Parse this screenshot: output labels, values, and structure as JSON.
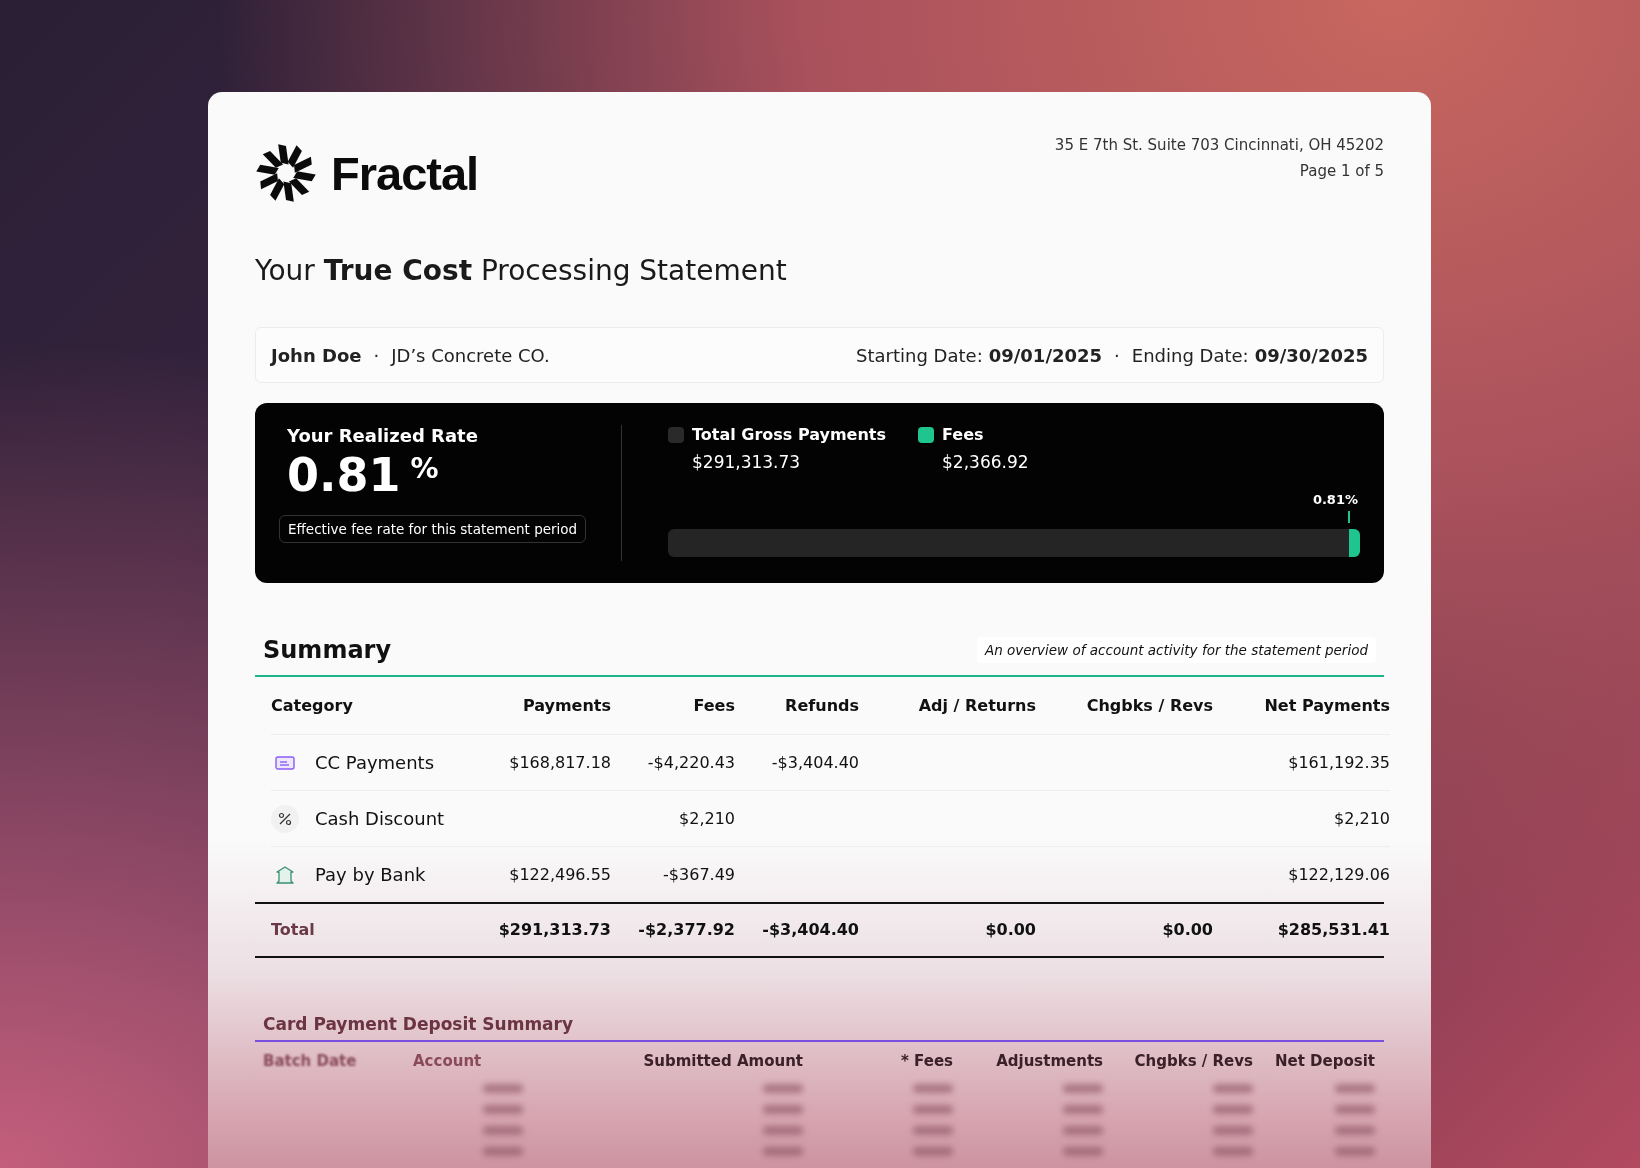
{
  "brand": {
    "name": "Fractal"
  },
  "address": "35 E 7th St. Suite 703 Cincinnati, OH 45202",
  "page": "Page 1 of 5",
  "title": "Your **True Cost** Processing Statement",
  "info": {
    "name": "John Doe",
    "separator": "·",
    "company": "JD’s Concrete CO.",
    "start_label": "Starting Date:",
    "start": "09/01/2025",
    "separator2": "·",
    "end_label": "Ending Date:",
    "end": "09/30/2025"
  },
  "rate": {
    "label": "Your Realized Rate",
    "value": "0.81",
    "unit": "%",
    "caption": "Effective fee rate for this statement period"
  },
  "legend": [
    {
      "label": "Total Gross Payments",
      "amount": "$291,313.73",
      "color": "#2a2a2a"
    },
    {
      "label": "Fees",
      "amount": "$2,366.92",
      "color": "#1fc58e"
    }
  ],
  "meter": {
    "level": 0.0081,
    "reading": "0.81%"
  },
  "summary": {
    "title": "Summary",
    "note": "An overview of account activity for the statement period",
    "columns": [
      "Category",
      "Payments",
      "Fees",
      "Refunds",
      "Adj / Returns",
      "Chgbks / Revs",
      "Net Payments"
    ],
    "rows": [
      {
        "kind": "card",
        "cells": [
          "CC Payments",
          "$168,817.18",
          "-$4,220.43",
          "-$3,404.40",
          "",
          "",
          "$161,192.35"
        ]
      },
      {
        "kind": "percent",
        "cells": [
          "Cash Discount",
          "",
          "$2,210",
          "",
          "",
          "",
          "$2,210"
        ]
      },
      {
        "kind": "bank",
        "cells": [
          "Pay by Bank",
          "$122,496.55",
          "-$367.49",
          "",
          "",
          "",
          "$122,129.06"
        ]
      }
    ],
    "total": [
      "Total",
      "$291,313.73",
      "-$2,377.92",
      "-$3,404.40",
      "$0.00",
      "$0.00",
      "$285,531.41"
    ]
  },
  "deposit": {
    "title": "Card Payment Deposit Summary",
    "columns": [
      "Batch Date",
      "Account",
      "Submitted Amount",
      "* Fees",
      "Adjustments",
      "Chgbks / Revs",
      "Net Deposit"
    ]
  }
}
